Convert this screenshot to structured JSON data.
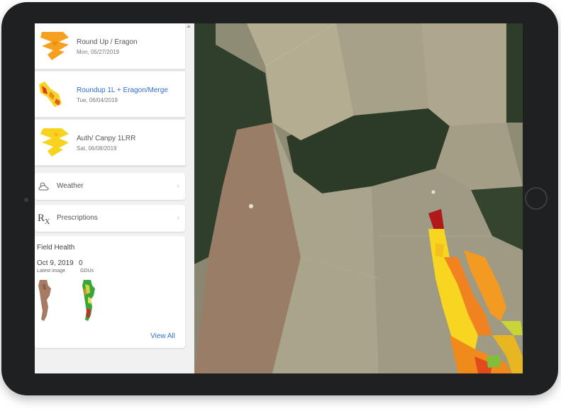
{
  "applications": [
    {
      "title": "Round Up / Eragon",
      "date": "Mon, 05/27/2019",
      "thumb_color": "#f7a020"
    },
    {
      "title": "Roundup 1L + Eragon/Merge",
      "date": "Tue, 06/04/2019",
      "thumb_color": "#f6d32a"
    },
    {
      "title": "Auth/ Canpy 1LRR",
      "date": "Sat, 06/08/2019",
      "thumb_color": "#f8d21c"
    }
  ],
  "sections": {
    "weather": {
      "label": "Weather",
      "icon": "weather-icon"
    },
    "prescriptions": {
      "label": "Prescriptions",
      "icon": "rx-icon",
      "icon_text": "R",
      "icon_sub": "X"
    }
  },
  "field_health": {
    "title": "Field Health",
    "image_date": "Oct 9, 2019",
    "image_label": "Latest image",
    "gdu_value": "0",
    "gdu_label": "GDUs",
    "view_all": "View All"
  },
  "colors": {
    "link": "#2f6fd0",
    "tablet_bezel": "#1f2022",
    "app_orange": "#f7a020",
    "health_red": "#c0302a",
    "health_green": "#3aa53a"
  }
}
